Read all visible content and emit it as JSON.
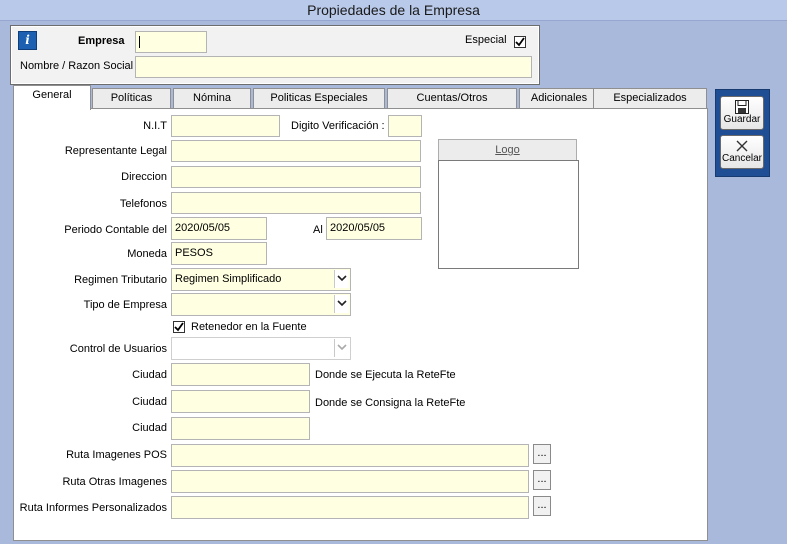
{
  "window": {
    "title": "Propiedades de la Empresa"
  },
  "header": {
    "info_icon": "info-icon",
    "empresa_label": "Empresa",
    "empresa_value": "",
    "especial_label": "Especial",
    "especial_checked": true,
    "nombre_label": "Nombre / Razon Social",
    "nombre_value": ""
  },
  "tabs": [
    {
      "label": "General",
      "active": true
    },
    {
      "label": "Políticas"
    },
    {
      "label": "Nómina"
    },
    {
      "label": "Politicas Especiales"
    },
    {
      "label": "Cuentas/Otros"
    },
    {
      "label": "Adicionales"
    },
    {
      "label": "Especializados"
    }
  ],
  "general": {
    "nit_label": "N.I.T",
    "nit_value": "",
    "digito_label": "Digito Verificación :",
    "digito_value": "",
    "representante_label": "Representante Legal",
    "representante_value": "",
    "direccion_label": "Direccion",
    "direccion_value": "",
    "telefonos_label": "Telefonos",
    "telefonos_value": "",
    "periodo_label": "Periodo Contable del",
    "periodo_desde": "2020/05/05",
    "al_label": "Al",
    "periodo_hasta": "2020/05/05",
    "moneda_label": "Moneda",
    "moneda_value": "PESOS",
    "regimen_label": "Regimen Tributario",
    "regimen_value": "Regimen Simplificado",
    "tipo_label": "Tipo de Empresa",
    "tipo_value": "",
    "retenedor_label": "Retenedor en la Fuente",
    "retenedor_checked": true,
    "control_label": "Control de Usuarios",
    "control_value": "",
    "ciudad1_label": "Ciudad",
    "ciudad1_value": "",
    "ciudad1_hint": "Donde se Ejecuta  la ReteFte",
    "ciudad2_label": "Ciudad",
    "ciudad2_value": "",
    "ciudad2_hint": "Donde se Consigna la ReteFte",
    "ciudad3_label": "Ciudad",
    "ciudad3_value": "",
    "ruta_pos_label": "Ruta Imagenes POS",
    "ruta_pos_value": "",
    "ruta_otras_label": "Ruta Otras Imagenes",
    "ruta_otras_value": "",
    "ruta_informes_label": "Ruta Informes Personalizados",
    "ruta_informes_value": "",
    "browse_label": "...",
    "logo_label": "Logo"
  },
  "actions": {
    "guardar_label": "Guardar",
    "guardar_icon": "save-icon",
    "cancelar_label": "Cancelar",
    "cancelar_icon": "close-icon"
  }
}
